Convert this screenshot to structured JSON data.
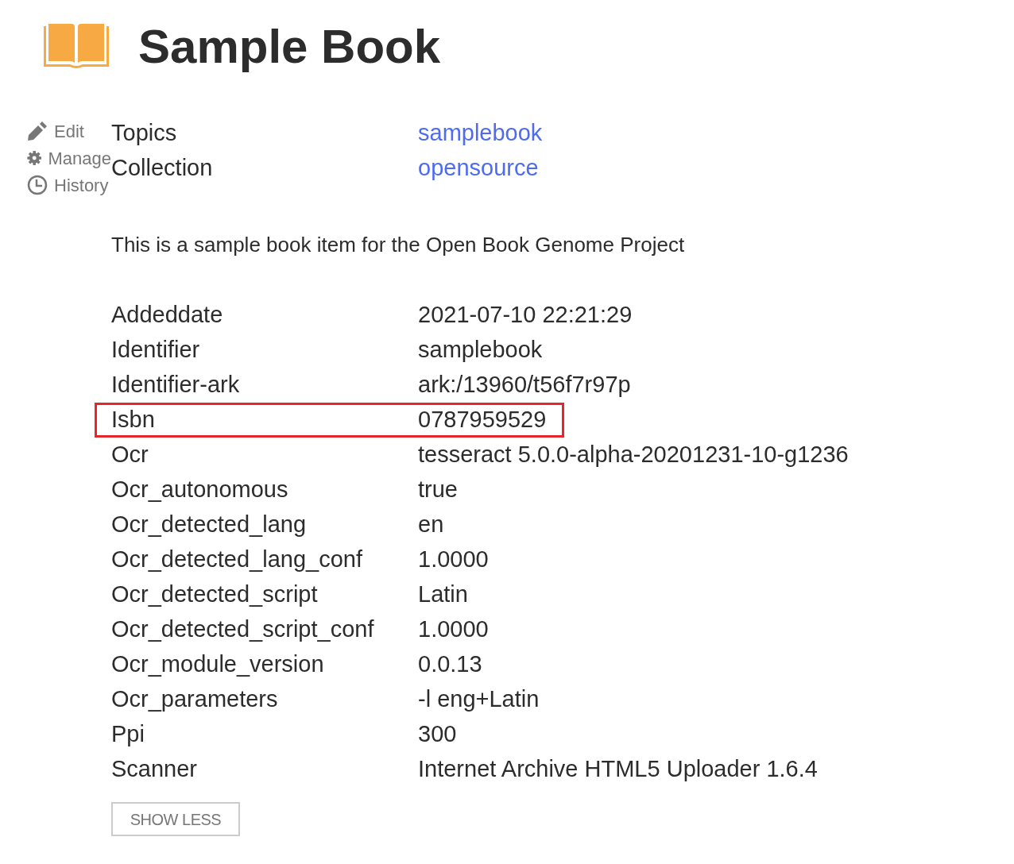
{
  "title": "Sample Book",
  "actions": [
    {
      "kind": "edit",
      "label": "Edit"
    },
    {
      "kind": "manage",
      "label": "Manage"
    },
    {
      "kind": "history",
      "label": "History"
    }
  ],
  "links": [
    {
      "label": "Topics",
      "value": "samplebook"
    },
    {
      "label": "Collection",
      "value": "opensource"
    }
  ],
  "description": "This is a sample book item for the Open Book Genome Project",
  "metadata": [
    {
      "label": "Addeddate",
      "value": "2021-07-10 22:21:29",
      "highlighted": false
    },
    {
      "label": "Identifier",
      "value": "samplebook",
      "highlighted": false
    },
    {
      "label": "Identifier-ark",
      "value": "ark:/13960/t56f7r97p",
      "highlighted": false
    },
    {
      "label": "Isbn",
      "value": "0787959529",
      "highlighted": true
    },
    {
      "label": "Ocr",
      "value": "tesseract 5.0.0-alpha-20201231-10-g1236",
      "highlighted": false
    },
    {
      "label": "Ocr_autonomous",
      "value": "true",
      "highlighted": false
    },
    {
      "label": "Ocr_detected_lang",
      "value": "en",
      "highlighted": false
    },
    {
      "label": "Ocr_detected_lang_conf",
      "value": "1.0000",
      "highlighted": false
    },
    {
      "label": "Ocr_detected_script",
      "value": "Latin",
      "highlighted": false
    },
    {
      "label": "Ocr_detected_script_conf",
      "value": "1.0000",
      "highlighted": false
    },
    {
      "label": "Ocr_module_version",
      "value": "0.0.13",
      "highlighted": false
    },
    {
      "label": "Ocr_parameters",
      "value": "-l eng+Latin",
      "highlighted": false
    },
    {
      "label": "Ppi",
      "value": "300",
      "highlighted": false
    },
    {
      "label": "Scanner",
      "value": "Internet Archive HTML5 Uploader 1.6.4",
      "highlighted": false
    }
  ],
  "toggle_button": "SHOW LESS"
}
